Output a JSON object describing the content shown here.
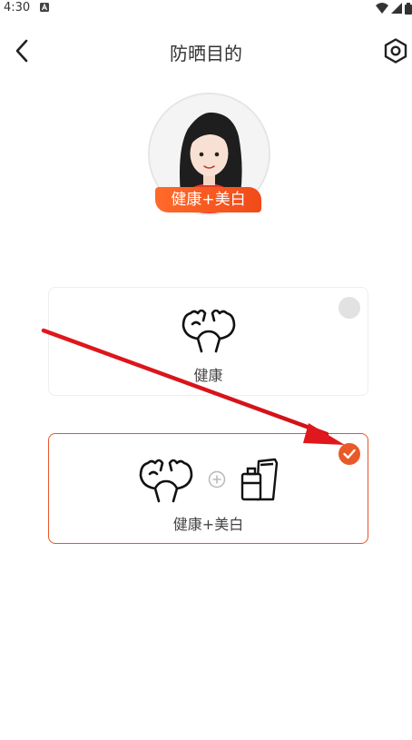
{
  "status": {
    "time": "4:30"
  },
  "header": {
    "title": "防晒目的"
  },
  "avatar": {
    "badge": "健康+美白"
  },
  "options": [
    {
      "label": "健康",
      "selected": false
    },
    {
      "label": "健康+美白",
      "selected": true
    }
  ],
  "colors": {
    "accent": "#e85a28",
    "annotation_arrow": "#e0181d"
  },
  "icons": [
    "back-arrow-icon",
    "settings-hex-icon",
    "muscle-arms-icon",
    "plus-circle-icon",
    "cosmetics-bottle-icon",
    "checkmark-icon"
  ]
}
